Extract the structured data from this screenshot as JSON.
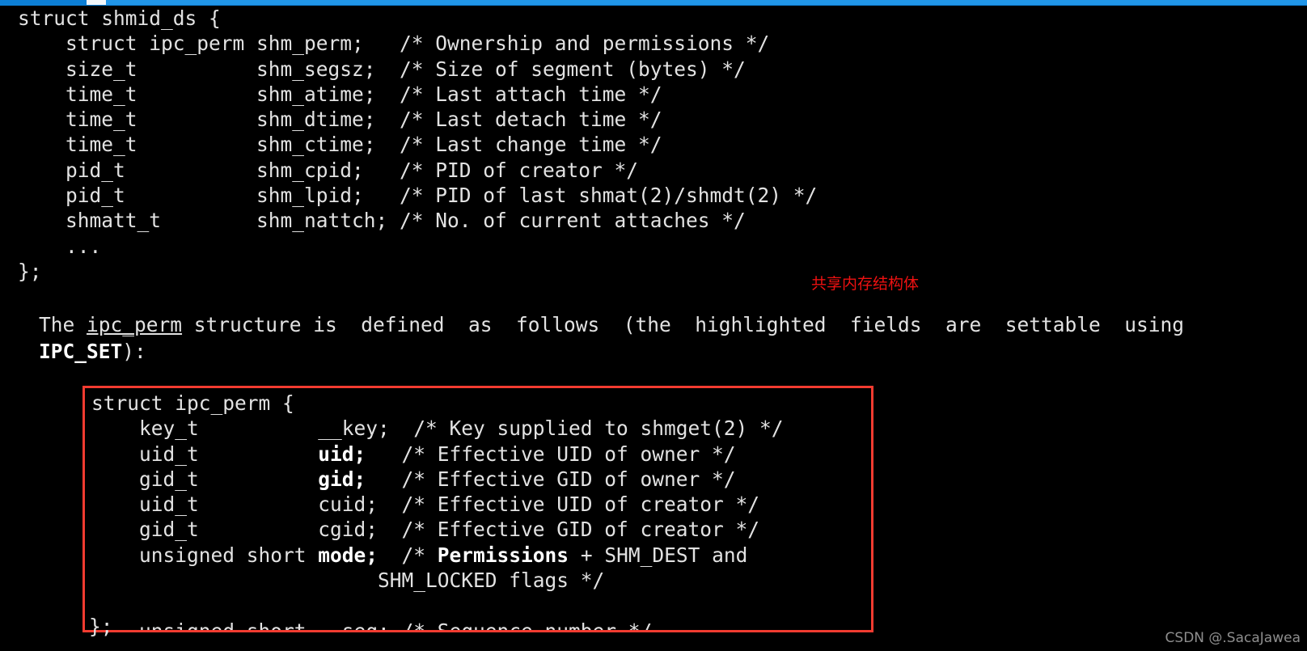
{
  "window": {
    "background_color": "#000000",
    "text_color": "#e2e2e2",
    "top_bar_color": "#0c7fd6",
    "top_bar_thumb_color": "#f2f6f9",
    "accent_red": "#f23b30",
    "annotation_red": "#ee1111"
  },
  "shmid_ds": {
    "lines": [
      "struct shmid_ds {",
      "    struct ipc_perm shm_perm;   /* Ownership and permissions */",
      "    size_t          shm_segsz;  /* Size of segment (bytes) */",
      "    time_t          shm_atime;  /* Last attach time */",
      "    time_t          shm_dtime;  /* Last detach time */",
      "    time_t          shm_ctime;  /* Last change time */",
      "    pid_t           shm_cpid;   /* PID of creator */",
      "    pid_t           shm_lpid;   /* PID of last shmat(2)/shmdt(2) */",
      "    shmatt_t        shm_nattch; /* No. of current attaches */",
      "    ...",
      "};"
    ]
  },
  "annotation": {
    "chinese_note": "共享内存结构体"
  },
  "paragraph": {
    "line1_part1": "The ",
    "line1_underlined": "ipc_perm",
    "line1_part2": " structure is  defined  as  follows  (the  highlighted  fields  are  settable  using",
    "line2_bold": "IPC_SET",
    "line2_rest": "):"
  },
  "ipc_perm": {
    "header": "struct ipc_perm {",
    "rows": [
      {
        "type": "    key_t          ",
        "field": "__key;",
        "field_bold": false,
        "comment_pre": "  /* Key supplied to shmget(2) */",
        "comment_bold": "",
        "comment_post": ""
      },
      {
        "type": "    uid_t          ",
        "field": "uid;",
        "field_bold": true,
        "comment_pre": "   /* Effective UID of owner */",
        "comment_bold": "",
        "comment_post": ""
      },
      {
        "type": "    gid_t          ",
        "field": "gid;",
        "field_bold": true,
        "comment_pre": "   /* Effective GID of owner */",
        "comment_bold": "",
        "comment_post": ""
      },
      {
        "type": "    uid_t          ",
        "field": "cuid;",
        "field_bold": false,
        "comment_pre": "  /* Effective UID of creator */",
        "comment_bold": "",
        "comment_post": ""
      },
      {
        "type": "    gid_t          ",
        "field": "cgid;",
        "field_bold": false,
        "comment_pre": "  /* Effective GID of creator */",
        "comment_bold": "",
        "comment_post": ""
      },
      {
        "type": "    unsigned short ",
        "field": "mode;",
        "field_bold": true,
        "comment_pre": "  /* ",
        "comment_bold": "Permissions",
        "comment_post": " + SHM_DEST and"
      },
      {
        "type": "                   ",
        "field": "",
        "field_bold": false,
        "comment_pre": "     SHM_LOCKED flags */",
        "comment_bold": "",
        "comment_post": ""
      },
      {
        "type": "",
        "field": "",
        "field_bold": false,
        "comment_pre": "",
        "comment_bold": "",
        "comment_post": ""
      },
      {
        "type": "    unsigned short ",
        "field": "__seq;",
        "field_bold": false,
        "comment_pre": " /* Sequence number */",
        "comment_bold": "",
        "comment_post": ""
      }
    ],
    "footer": "};"
  },
  "watermark": {
    "text": "CSDN @.SacaJawea"
  }
}
